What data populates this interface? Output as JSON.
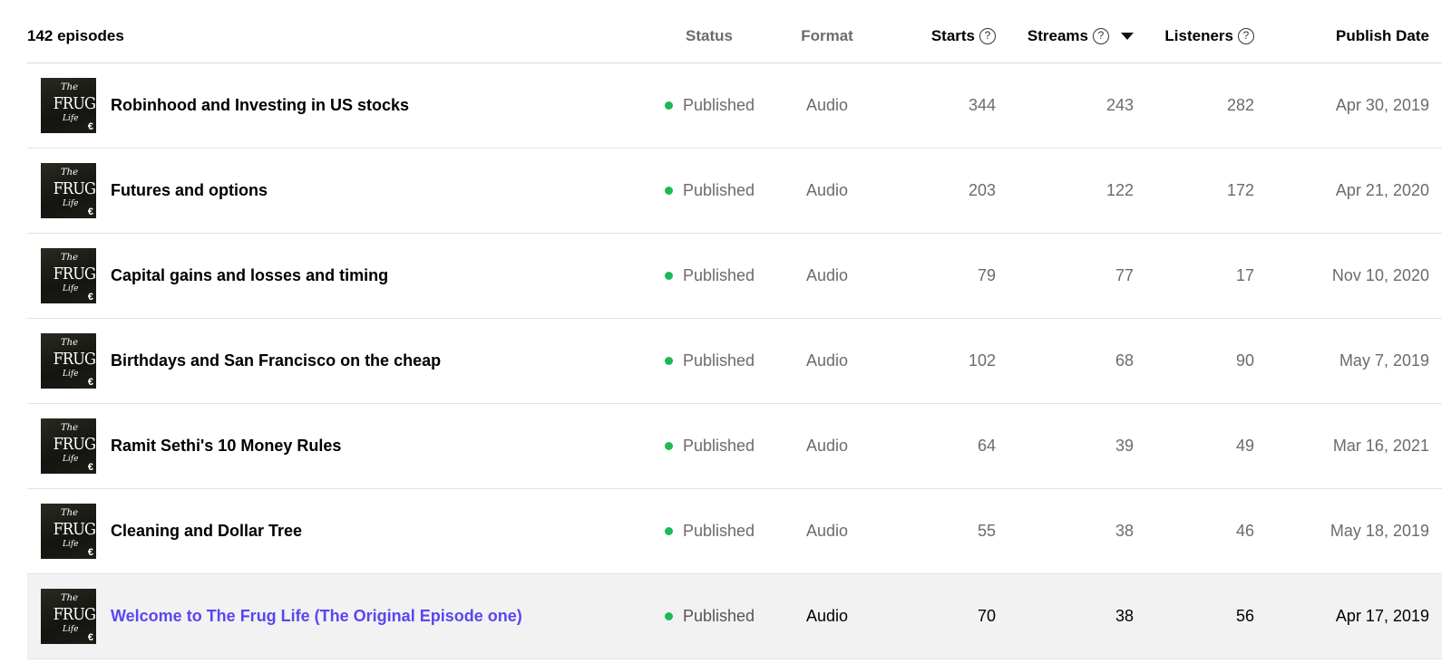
{
  "header": {
    "count": "142 episodes",
    "status": "Status",
    "format": "Format",
    "starts": "Starts",
    "streams": "Streams",
    "listeners": "Listeners",
    "publish_date": "Publish Date",
    "help_glyph": "?",
    "sort_icon": "caret-down-icon"
  },
  "thumbnail": {
    "line1": "The",
    "line2": "FRUG",
    "line3": "Life",
    "symbol": "€"
  },
  "episodes": [
    {
      "title": "Robinhood and Investing in US stocks",
      "status": "Published",
      "format": "Audio",
      "starts": "344",
      "streams": "243",
      "listeners": "282",
      "date": "Apr 30, 2019"
    },
    {
      "title": "Futures and options",
      "status": "Published",
      "format": "Audio",
      "starts": "203",
      "streams": "122",
      "listeners": "172",
      "date": "Apr 21, 2020"
    },
    {
      "title": "Capital gains and losses and timing",
      "status": "Published",
      "format": "Audio",
      "starts": "79",
      "streams": "77",
      "listeners": "17",
      "date": "Nov 10, 2020"
    },
    {
      "title": "Birthdays and San Francisco on the cheap",
      "status": "Published",
      "format": "Audio",
      "starts": "102",
      "streams": "68",
      "listeners": "90",
      "date": "May 7, 2019"
    },
    {
      "title": "Ramit Sethi's 10 Money Rules",
      "status": "Published",
      "format": "Audio",
      "starts": "64",
      "streams": "39",
      "listeners": "49",
      "date": "Mar 16, 2021"
    },
    {
      "title": "Cleaning and Dollar Tree",
      "status": "Published",
      "format": "Audio",
      "starts": "55",
      "streams": "38",
      "listeners": "46",
      "date": "May 18, 2019"
    },
    {
      "title": "Welcome to The Frug Life (The Original Episode one)",
      "status": "Published",
      "format": "Audio",
      "starts": "70",
      "streams": "38",
      "listeners": "56",
      "date": "Apr 17, 2019"
    }
  ],
  "colors": {
    "published_dot": "#1db954",
    "hover_title": "#5b46f0",
    "hover_row_bg": "#f2f2f2"
  }
}
